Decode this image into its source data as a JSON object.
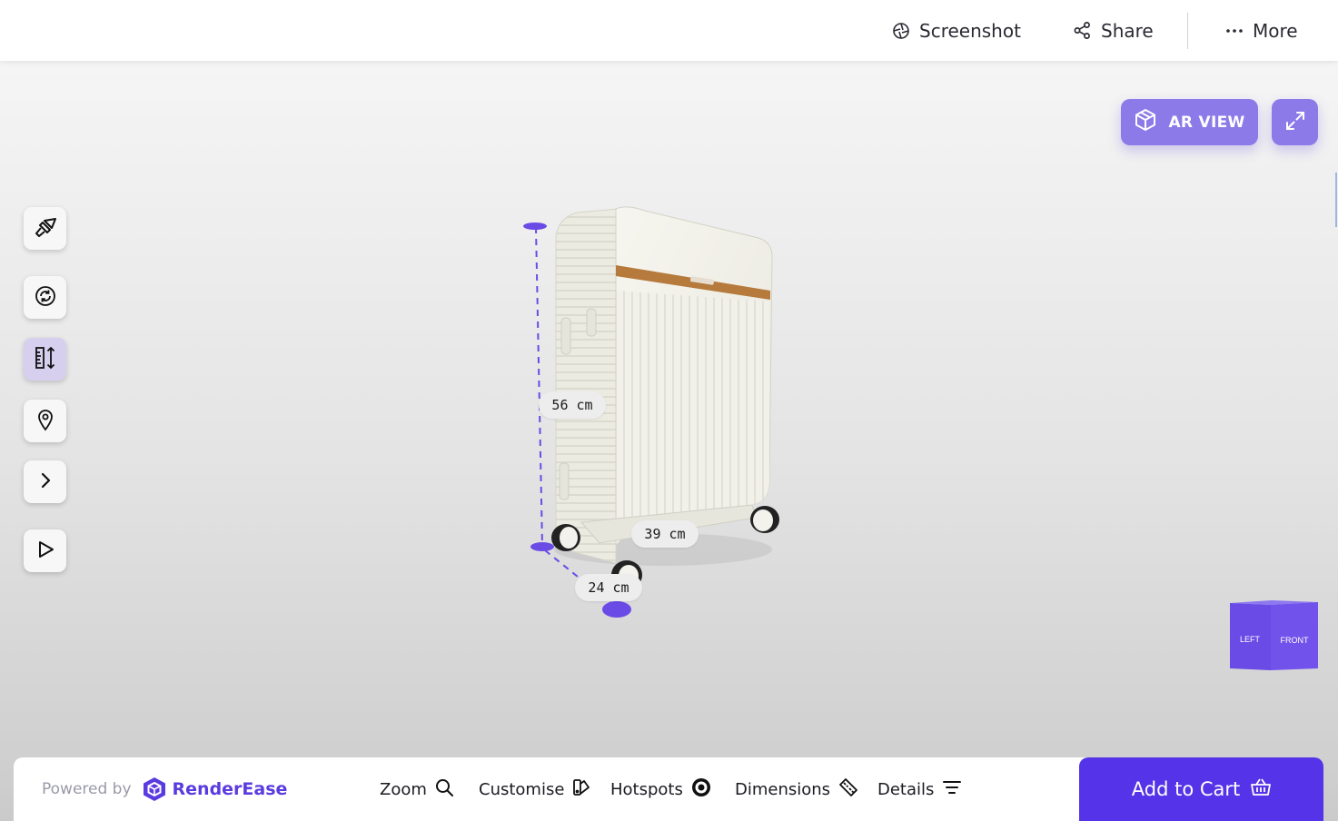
{
  "topbar": {
    "screenshot_label": "Screenshot",
    "share_label": "Share",
    "more_label": "More"
  },
  "viewer": {
    "ar_label": "AR VIEW",
    "accent_color": "#8b7ae8",
    "dimension_line_color": "#6a4be6",
    "dimensions": {
      "height": "56 cm",
      "width": "39 cm",
      "depth": "24 cm"
    },
    "view_cube": {
      "left_face": "LEFT",
      "front_face": "FRONT"
    },
    "left_tools": [
      {
        "name": "brush-icon",
        "active": false
      },
      {
        "name": "rotate-icon",
        "active": false
      },
      {
        "name": "ruler-icon",
        "active": true
      },
      {
        "name": "location-pin-icon",
        "active": false
      },
      {
        "name": "chevron-right-icon",
        "active": false
      },
      {
        "name": "play-icon",
        "active": false
      }
    ]
  },
  "bottombar": {
    "powered_by": "Powered by",
    "brand_name": "RenderEase",
    "nav": {
      "zoom": "Zoom",
      "customise": "Customise",
      "hotspots": "Hotspots",
      "dimensions": "Dimensions",
      "details": "Details"
    },
    "cart_label": "Add to Cart",
    "cart_color": "#5433e8"
  }
}
